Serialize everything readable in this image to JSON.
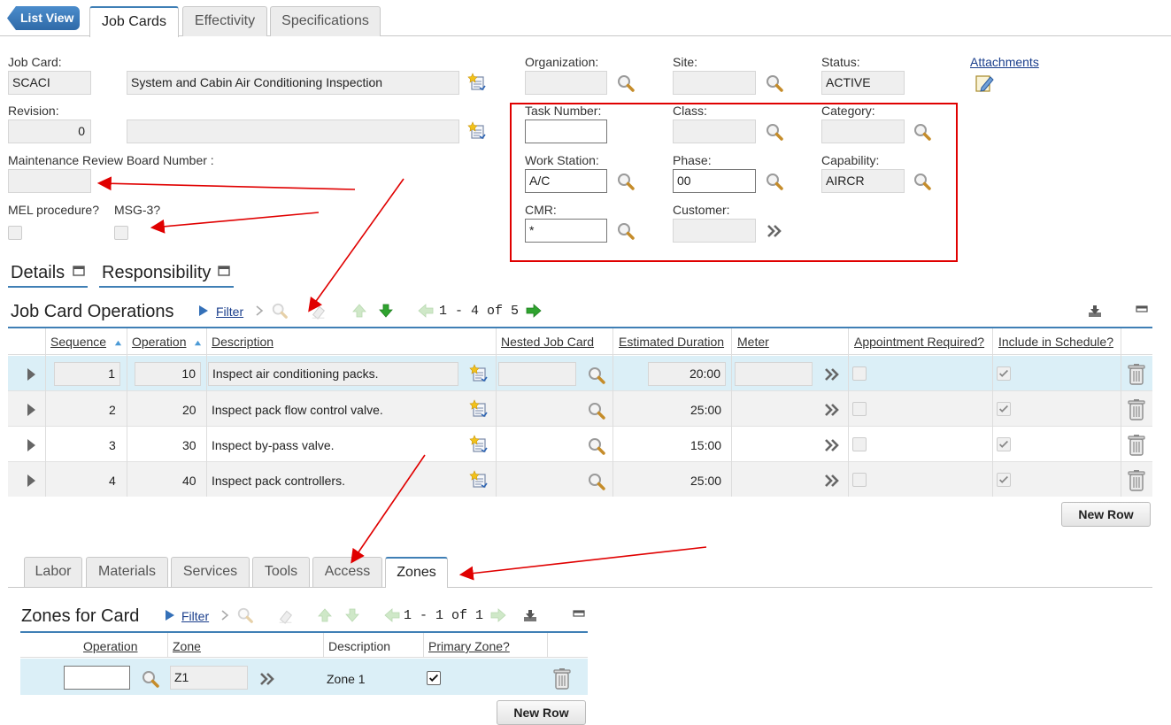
{
  "top_tabs": {
    "list_view": "List View",
    "job_cards": "Job Cards",
    "effectivity": "Effectivity",
    "specifications": "Specifications"
  },
  "header": {
    "job_card_label": "Job Card:",
    "job_card_value": "SCACI",
    "job_card_desc": "System and Cabin Air Conditioning Inspection",
    "revision_label": "Revision:",
    "revision_value": "0",
    "revision_desc": "",
    "mrb_label": "Maintenance Review Board Number :",
    "mrb_value": "",
    "mel_label": "MEL procedure?",
    "msg3_label": "MSG-3?",
    "organization_label": "Organization:",
    "organization_value": "",
    "site_label": "Site:",
    "site_value": "",
    "status_label": "Status:",
    "status_value": "ACTIVE",
    "attachments_label": "Attachments",
    "task_number_label": "Task Number:",
    "task_number_value": "",
    "class_label": "Class:",
    "class_value": "",
    "category_label": "Category:",
    "category_value": "",
    "work_station_label": "Work Station:",
    "work_station_value": "A/C",
    "phase_label": "Phase:",
    "phase_value": "00",
    "capability_label": "Capability:",
    "capability_value": "AIRCR",
    "cmr_label": "CMR:",
    "cmr_value": "*",
    "customer_label": "Customer:",
    "customer_value": ""
  },
  "section_tabs": {
    "details": "Details",
    "responsibility": "Responsibility"
  },
  "operations": {
    "title": "Job Card Operations",
    "filter": "Filter",
    "pagination": "1 - 4 of 5",
    "columns": [
      "Sequence",
      "Operation",
      "Description",
      "Nested Job Card",
      "Estimated Duration",
      "Meter",
      "Appointment Required?",
      "Include in Schedule?"
    ],
    "rows": [
      {
        "sequence": "1",
        "operation": "10",
        "description": "Inspect air conditioning packs.",
        "nested": "",
        "duration": "20:00",
        "meter": ""
      },
      {
        "sequence": "2",
        "operation": "20",
        "description": "Inspect pack flow control valve.",
        "nested": "",
        "duration": "25:00",
        "meter": ""
      },
      {
        "sequence": "3",
        "operation": "30",
        "description": "Inspect by-pass valve.",
        "nested": "",
        "duration": "15:00",
        "meter": ""
      },
      {
        "sequence": "4",
        "operation": "40",
        "description": "Inspect pack controllers.",
        "nested": "",
        "duration": "25:00",
        "meter": ""
      }
    ],
    "new_row": "New Row"
  },
  "bottom_tabs": [
    "Labor",
    "Materials",
    "Services",
    "Tools",
    "Access",
    "Zones"
  ],
  "zones": {
    "title": "Zones for Card",
    "filter": "Filter",
    "pagination": "1 - 1 of 1",
    "columns": [
      "Operation",
      "Zone",
      "Description",
      "Primary Zone?"
    ],
    "row": {
      "operation": "",
      "zone": "Z1",
      "description": "Zone 1",
      "primary": true
    },
    "new_row": "New Row"
  },
  "colors": {
    "accent": "#3f7fb5",
    "selected_row": "#dbeff7",
    "annotation": "#e00000"
  }
}
